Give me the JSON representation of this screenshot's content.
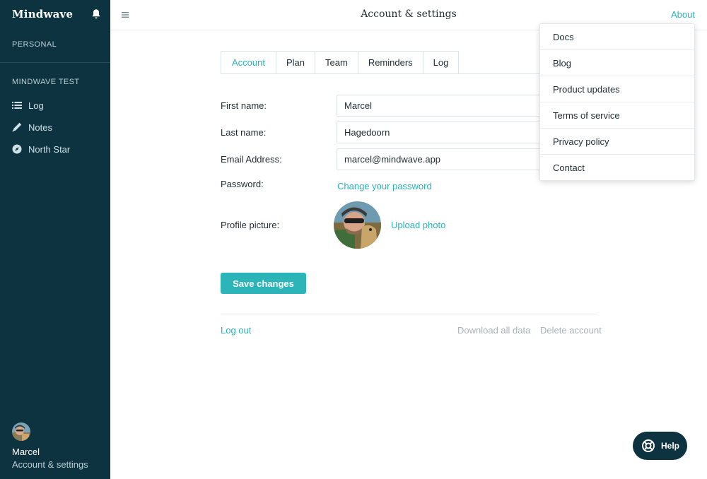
{
  "sidebar": {
    "brand": "Mindwave",
    "section_personal": "PERSONAL",
    "section_test": "MINDWAVE TEST",
    "items": [
      {
        "label": "Log",
        "icon": "list-icon"
      },
      {
        "label": "Notes",
        "icon": "pencil-icon"
      },
      {
        "label": "North Star",
        "icon": "compass-icon"
      }
    ],
    "user": {
      "name": "Marcel",
      "settings_link": "Account & settings"
    }
  },
  "header": {
    "title": "Account & settings",
    "about_label": "About"
  },
  "tabs": [
    "Account",
    "Plan",
    "Team",
    "Reminders",
    "Log"
  ],
  "active_tab": "Account",
  "form": {
    "first_name_label": "First name:",
    "first_name_value": "Marcel",
    "last_name_label": "Last name:",
    "last_name_value": "Hagedoorn",
    "email_label": "Email Address:",
    "email_value": "marcel@mindwave.app",
    "password_label": "Password:",
    "change_password": "Change your password",
    "profile_label": "Profile picture:",
    "upload_photo": "Upload photo",
    "save_label": "Save changes"
  },
  "footer_links": {
    "logout": "Log out",
    "download": "Download all data",
    "delete": "Delete account"
  },
  "about_menu": [
    "Docs",
    "Blog",
    "Product updates",
    "Terms of service",
    "Privacy policy",
    "Contact"
  ],
  "help_label": "Help",
  "colors": {
    "sidebar_bg": "#0d3340",
    "accent": "#2ab4b8",
    "muted_link": "#a7b3b8"
  }
}
